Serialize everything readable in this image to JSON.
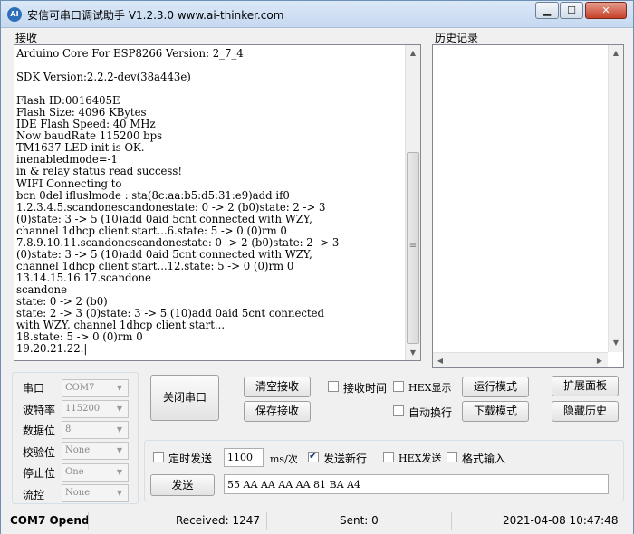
{
  "window": {
    "app_icon": "AI",
    "title": "安信可串口调试助手 V1.2.3.0    www.ai-thinker.com",
    "minimize_glyph": "▁",
    "maximize_glyph": "☐",
    "close_glyph": "✕"
  },
  "receive": {
    "label": "接收",
    "text": "Arduino Core For ESP8266 Version: 2_7_4\n\nSDK Version:2.2.2-dev(38a443e)\n\nFlash ID:0016405E\nFlash Size: 4096 KBytes\nIDE Flash Speed: 40 MHz\nNow baudRate 115200 bps\nTM1637 LED init is OK.\ninenabledmode=-1\nin & relay status read success!\nWIFI Connecting to\nbcn 0del ifluslmode : sta(8c:aa:b5:d5:31:e9)add if0\n1.2.3.4.5.scandonescandonestate: 0 -> 2 (b0)state: 2 -> 3\n(0)state: 3 -> 5 (10)add 0aid 5cnt connected with WZY,\nchannel 1dhcp client start...6.state: 5 -> 0 (0)rm 0\n7.8.9.10.11.scandonescandonestate: 0 -> 2 (b0)state: 2 -> 3\n(0)state: 3 -> 5 (10)add 0aid 5cnt connected with WZY,\nchannel 1dhcp client start...12.state: 5 -> 0 (0)rm 0\n13.14.15.16.17.scandone\nscandone\nstate: 0 -> 2 (b0)\nstate: 2 -> 3 (0)state: 3 -> 5 (10)add 0aid 5cnt connected\nwith WZY, channel 1dhcp client start...\n18.state: 5 -> 0 (0)rm 0\n19.20.21.22.|",
    "scroll_up": "▲",
    "scroll_down": "▼",
    "grip": "≡"
  },
  "history": {
    "label": "历史记录",
    "scroll_up": "▲",
    "scroll_down": "▼",
    "scroll_left": "◀",
    "scroll_right": "▶"
  },
  "serial": {
    "port_label": "串口",
    "port_value": "COM7",
    "baud_label": "波特率",
    "baud_value": "115200",
    "databits_label": "数据位",
    "databits_value": "8",
    "parity_label": "校验位",
    "parity_value": "None",
    "stopbits_label": "停止位",
    "stopbits_value": "One",
    "flow_label": "流控",
    "flow_value": "None",
    "combo_arrow": "▼"
  },
  "controls": {
    "close_port": "关闭串口",
    "clear_receive": "清空接收",
    "save_receive": "保存接收",
    "recv_time": "接收时间",
    "hex_display": "HEX显示",
    "auto_newline": "自动换行",
    "run_mode": "运行模式",
    "download_mode": "下载模式",
    "expand_panel": "扩展面板",
    "hide_history": "隐藏历史"
  },
  "send": {
    "timed_send": "定时发送",
    "interval_value": "1100",
    "interval_unit": "ms/次",
    "send_newline": "发送新行",
    "send_newline_checked": true,
    "hex_send": "HEX发送",
    "format_input": "格式输入",
    "send_button": "发送",
    "send_value": "55 AA AA AA AA 81 BA A4"
  },
  "status": {
    "port_state": "COM7 Opend",
    "received": "Received: 1247",
    "sent": "Sent: 0",
    "datetime": "2021-04-08 10:47:48"
  }
}
